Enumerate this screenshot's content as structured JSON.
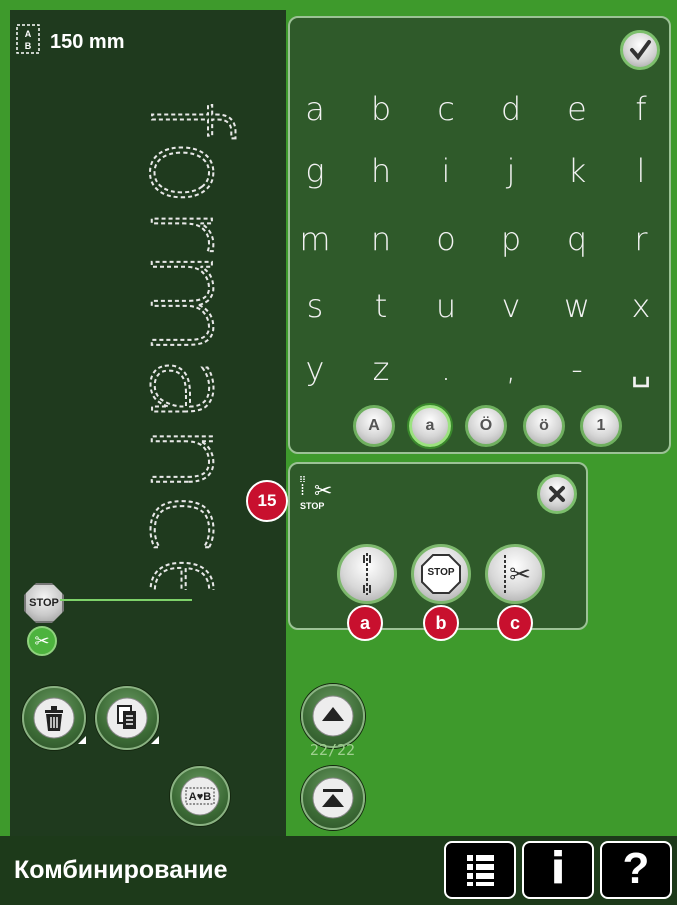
{
  "header": {
    "length_value": "150 mm",
    "preview_word": "formance"
  },
  "keyboard": {
    "keys": [
      "a",
      "b",
      "c",
      "d",
      "e",
      "f",
      "g",
      "h",
      "i",
      "j",
      "k",
      "l",
      "m",
      "n",
      "o",
      "p",
      "q",
      "r",
      "s",
      "t",
      "u",
      "v",
      "w",
      "x",
      "y",
      "z",
      ".",
      ",",
      "-",
      "␣"
    ],
    "modes": [
      "A",
      "a",
      "Ö",
      "ö",
      "1"
    ],
    "active_mode": "a"
  },
  "program_panel": {
    "label_top": "✂",
    "label_bottom": "STOP",
    "callout_number": "15",
    "stop_text": "STOP",
    "callouts": [
      "a",
      "b",
      "c"
    ]
  },
  "left_tools": {
    "stop_text": "STOP"
  },
  "pager": {
    "text": "22/22"
  },
  "footer": {
    "title": "Комбинирование",
    "help_label": "?",
    "info_label": "i"
  },
  "colors": {
    "background": "#3e9a2c",
    "panel": "#2f5a2a",
    "dark_panel": "#1f3a1e",
    "badge": "#c8102e"
  }
}
